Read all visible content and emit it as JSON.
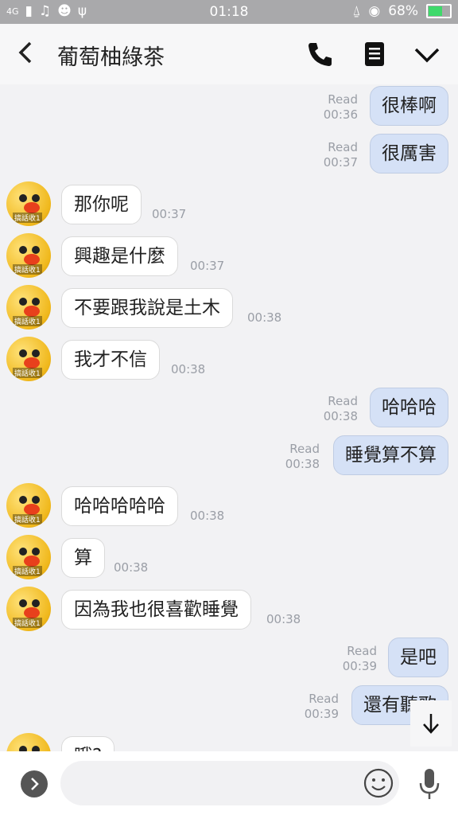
{
  "status_bar": {
    "network": "4G",
    "time": "01:18",
    "battery": "68%"
  },
  "header": {
    "title": "葡萄柚綠茶"
  },
  "messages": [
    {
      "dir": "out",
      "text": "很棒啊",
      "read": "Read",
      "time": "00:36"
    },
    {
      "dir": "out",
      "text": "很厲害",
      "read": "Read",
      "time": "00:37"
    },
    {
      "dir": "in",
      "text": "那你呢",
      "time": "00:37"
    },
    {
      "dir": "in",
      "text": "興趣是什麼",
      "time": "00:37"
    },
    {
      "dir": "in",
      "text": "不要跟我說是土木",
      "time": "00:38"
    },
    {
      "dir": "in",
      "text": "我才不信",
      "time": "00:38"
    },
    {
      "dir": "out",
      "text": "哈哈哈",
      "read": "Read",
      "time": "00:38"
    },
    {
      "dir": "out",
      "text": "睡覺算不算",
      "read": "Read",
      "time": "00:38"
    },
    {
      "dir": "in",
      "text": "哈哈哈哈哈",
      "time": "00:38"
    },
    {
      "dir": "in",
      "text": "算",
      "time": "00:38"
    },
    {
      "dir": "in",
      "text": "因為我也很喜歡睡覺",
      "time": "00:38"
    },
    {
      "dir": "out",
      "text": "是吧",
      "read": "Read",
      "time": "00:39"
    },
    {
      "dir": "out",
      "text": "還有聽歌",
      "read": "Read",
      "time": "00:39"
    },
    {
      "dir": "in",
      "text": "哦?",
      "time": ""
    }
  ],
  "avatar_tag": "搞話收1",
  "input": {
    "placeholder": ""
  },
  "colors": {
    "outgoing_bubble": "#d5e1f6",
    "incoming_bubble": "#ffffff",
    "background": "#f2f2f4"
  },
  "icons": {
    "back": "chevron-left-icon",
    "call": "phone-icon",
    "notes": "notes-icon",
    "menu": "chevron-down-icon",
    "scroll": "arrow-down-icon",
    "expand": "chevron-right-icon",
    "emoji": "smiley-icon",
    "mic": "microphone-icon"
  }
}
